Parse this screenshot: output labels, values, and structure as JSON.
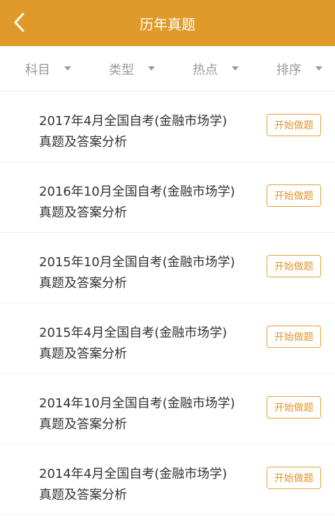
{
  "header": {
    "title": "历年真题",
    "back_icon": "chevron-left-icon",
    "background_color": "#e09a2a"
  },
  "filters": [
    {
      "label": "科目"
    },
    {
      "label": "类型"
    },
    {
      "label": "热点"
    },
    {
      "label": "排序"
    }
  ],
  "papers": [
    {
      "title_line1": "2017年4月全国自考(金融市场学)",
      "title_line2": "真题及答案分析",
      "button": "开始做题"
    },
    {
      "title_line1": "2016年10月全国自考(金融市场学)",
      "title_line2": "真题及答案分析",
      "button": "开始做题"
    },
    {
      "title_line1": "2015年10月全国自考(金融市场学)",
      "title_line2": "真题及答案分析",
      "button": "开始做题"
    },
    {
      "title_line1": "2015年4月全国自考(金融市场学)",
      "title_line2": "真题及答案分析",
      "button": "开始做题"
    },
    {
      "title_line1": "2014年10月全国自考(金融市场学)",
      "title_line2": "真题及答案分析",
      "button": "开始做题"
    },
    {
      "title_line1": "2014年4月全国自考(金融市场学)",
      "title_line2": "真题及答案分析",
      "button": "开始做题"
    }
  ]
}
